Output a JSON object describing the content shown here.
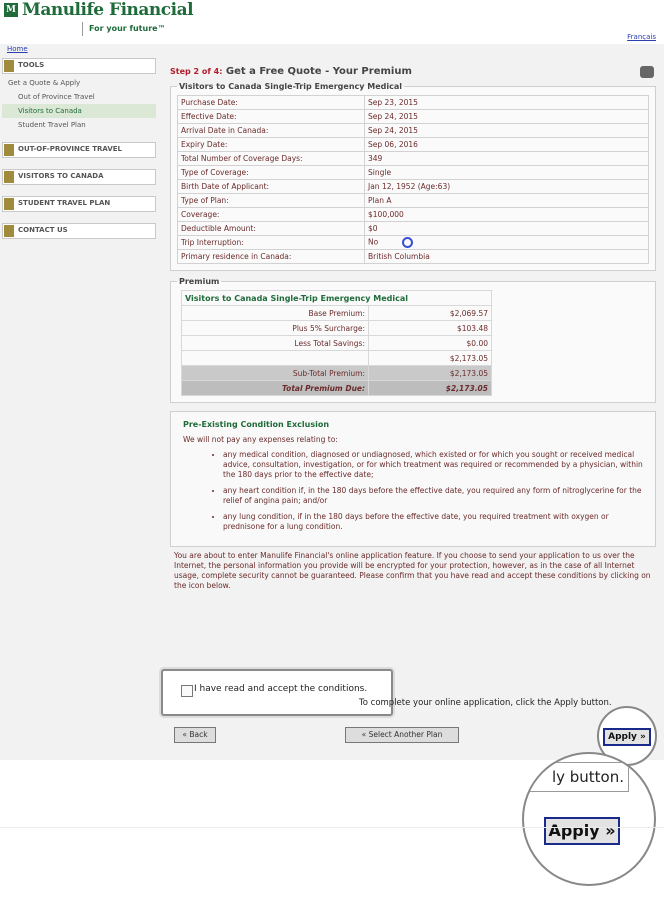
{
  "header": {
    "logo_glyph": "M",
    "brand": "Manulife Financial",
    "tagline": "For your future™"
  },
  "nav": {
    "home": "Home",
    "francais": "Français"
  },
  "sidebar": {
    "tools": "TOOLS",
    "tools_items": [
      "Get a Quote & Apply",
      "Out of Province Travel",
      "Visitors to Canada",
      "Student Travel Plan"
    ],
    "sections": [
      "OUT-OF-PROVINCE TRAVEL",
      "VISITORS TO CANADA",
      "STUDENT TRAVEL PLAN",
      "CONTACT US"
    ]
  },
  "main": {
    "step": "Step 2 of 4:",
    "title": "Get a Free Quote - Your Premium",
    "details_legend": "Visitors to Canada Single-Trip Emergency Medical",
    "details": [
      {
        "label": "Purchase Date:",
        "value": "Sep 23, 2015"
      },
      {
        "label": "Effective Date:",
        "value": "Sep 24, 2015"
      },
      {
        "label": "Arrival Date in Canada:",
        "value": "Sep 24, 2015"
      },
      {
        "label": "Expiry Date:",
        "value": "Sep 06, 2016"
      },
      {
        "label": "Total Number of Coverage Days:",
        "value": "349"
      },
      {
        "label": "Type of Coverage:",
        "value": "Single"
      },
      {
        "label": "Birth Date of Applicant:",
        "value": "Jan 12, 1952 (Age:63)"
      },
      {
        "label": "Type of Plan:",
        "value": "Plan A"
      },
      {
        "label": "Coverage:",
        "value": "$100,000"
      },
      {
        "label": "Deductible Amount:",
        "value": "$0"
      },
      {
        "label": "Trip Interruption:",
        "value": "No"
      },
      {
        "label": "Primary residence in Canada:",
        "value": "British Columbia"
      }
    ],
    "premium_legend": "Premium",
    "premium_title": "Visitors to Canada Single-Trip Emergency Medical",
    "premium_rows": [
      {
        "label": "Base Premium:",
        "value": "$2,069.57"
      },
      {
        "label": "Plus 5% Surcharge:",
        "value": "$103.48"
      },
      {
        "label": "Less Total Savings:",
        "value": "$0.00"
      },
      {
        "label": "",
        "value": "$2,173.05"
      },
      {
        "label": "Sub-Total Premium:",
        "value": "$2,173.05"
      }
    ],
    "total_label": "Total Premium Due:",
    "total_value": "$2,173.05",
    "preexisting_title": "Pre-Existing Condition Exclusion",
    "preexisting_intro": "We will not pay any expenses relating to:",
    "preexisting_items": [
      "any medical condition, diagnosed or undiagnosed, which existed or for which you sought or received medical advice, consultation, investigation, or for which treatment was required or recommended by a physician, within the 180 days prior to the effective date;",
      "any heart condition if, in the 180 days before the effective date, you required any form of nitroglycerine for the relief of angina pain; and/or",
      "any lung condition, if in the 180 days before the effective date, you required treatment with oxygen or prednisone for a lung condition."
    ],
    "notice": "You are about to enter Manulife Financial's online application feature. If you choose to send your application to us over the Internet, the personal information you provide will be encrypted for your protection, however, as in the case of all Internet usage, complete security cannot be guaranteed. Please confirm that you have read and accept these conditions by clicking on the icon below.",
    "accept_label": "I have read and accept the conditions.",
    "complete_note": "To complete your online application, click the Apply button.",
    "back_button": "« Back",
    "select_plan_button": "« Select Another Plan",
    "apply_button": "Apply »"
  },
  "zoom": {
    "lens_text": "ly button.",
    "apply_button": "Apply »"
  }
}
